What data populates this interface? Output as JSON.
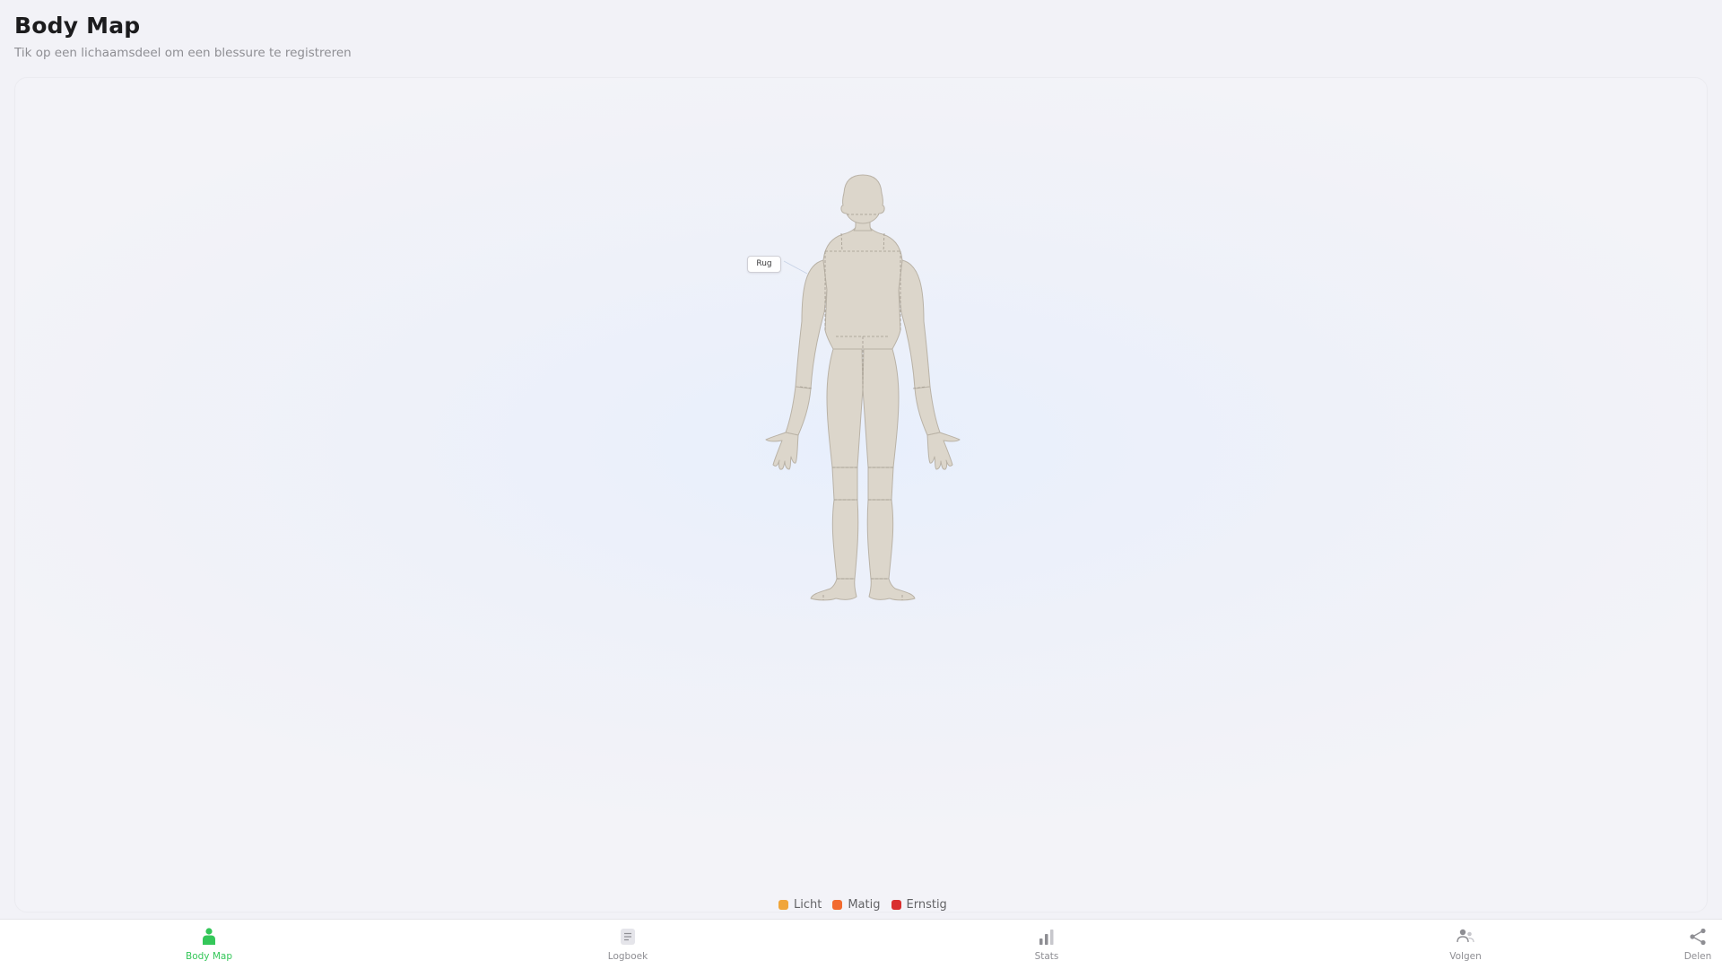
{
  "header": {
    "title": "Body Map",
    "subtitle": "Tik op een lichaamsdeel om een blessure te registreren"
  },
  "body_map": {
    "selected_region_label": "Rug"
  },
  "legend": [
    {
      "label": "Licht",
      "color": "#f0a53a"
    },
    {
      "label": "Matig",
      "color": "#f26b2f"
    },
    {
      "label": "Ernstig",
      "color": "#d92f2f"
    }
  ],
  "tabs": [
    {
      "label": "Body Map",
      "icon": "person-icon",
      "active": true
    },
    {
      "label": "Logboek",
      "icon": "logbook-icon",
      "active": false
    },
    {
      "label": "Stats",
      "icon": "bar-chart-icon",
      "active": false
    },
    {
      "label": "Volgen",
      "icon": "people-icon",
      "active": false
    },
    {
      "label": "Delen",
      "icon": "share-icon",
      "active": false
    }
  ],
  "colors": {
    "accent": "#34c759",
    "body_fill": "#dcd6cb",
    "body_outline": "#b9b2a6",
    "background": "#f2f2f7",
    "inactive_tab": "#8e8e93"
  }
}
